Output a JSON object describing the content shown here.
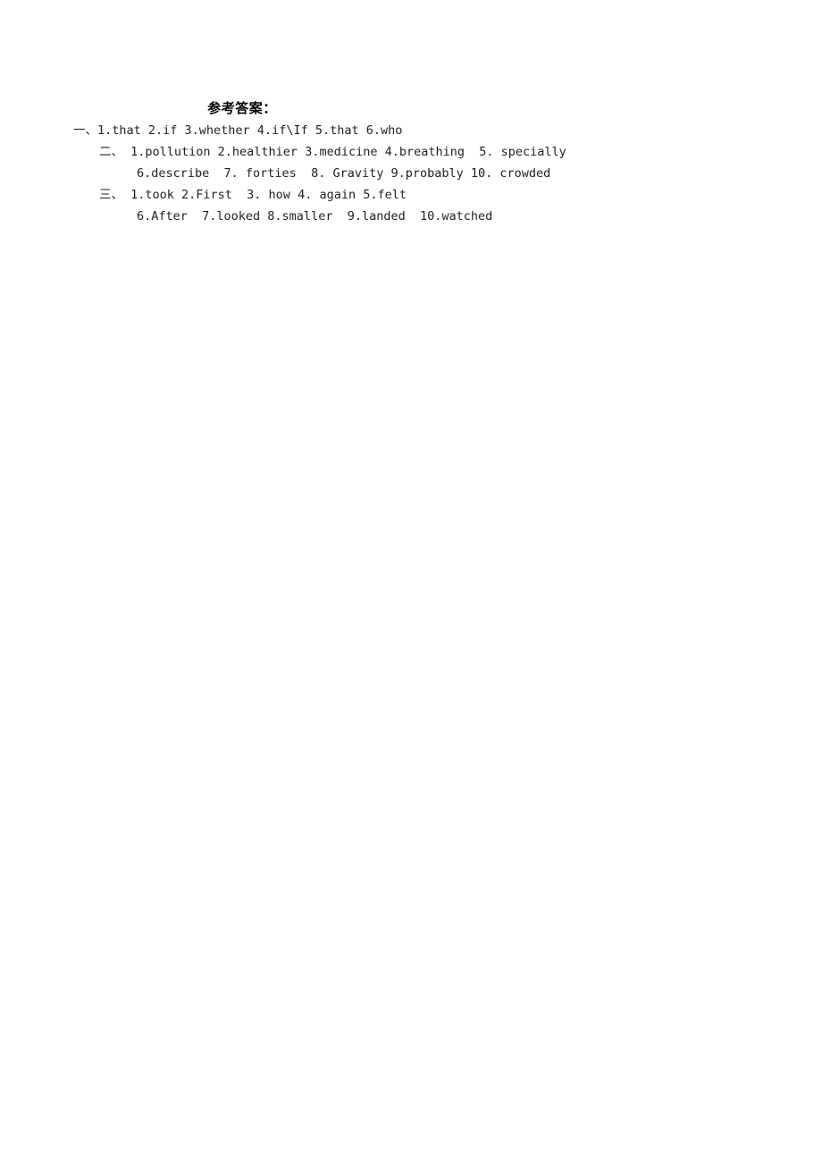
{
  "document": {
    "title": "参考答案：",
    "page_background": "#ffffff",
    "text_color": "#1f1f1f",
    "sections": [
      {
        "marker": "一、",
        "indent": "level-1",
        "lines": [
          "1.that 2.if 3.whether 4.if\\If 5.that 6.who"
        ]
      },
      {
        "marker": "二、",
        "indent": "level-2",
        "lines": [
          " 1.pollution 2.healthier 3.medicine 4.breathing  5. specially",
          "6.describe  7. forties  8. Gravity 9.probably 10. crowded"
        ]
      },
      {
        "marker": "三、",
        "indent": "level-2",
        "lines": [
          " 1.took 2.First  3. how 4. again 5.felt",
          "6.After  7.looked 8.smaller  9.landed  10.watched"
        ]
      }
    ],
    "rendered_lines": {
      "line_1_marker": "一、",
      "line_1_text": "1.that 2.if 3.whether 4.if\\If 5.that 6.who",
      "line_2_marker": "二、",
      "line_2_text": " 1.pollution 2.healthier 3.medicine 4.breathing  5. specially",
      "line_3_text": "6.describe  7. forties  8. Gravity 9.probably 10. crowded",
      "line_4_marker": "三、",
      "line_4_text": " 1.took 2.First  3. how 4. again 5.felt",
      "line_5_text": "6.After  7.looked 8.smaller  9.landed  10.watched"
    }
  }
}
